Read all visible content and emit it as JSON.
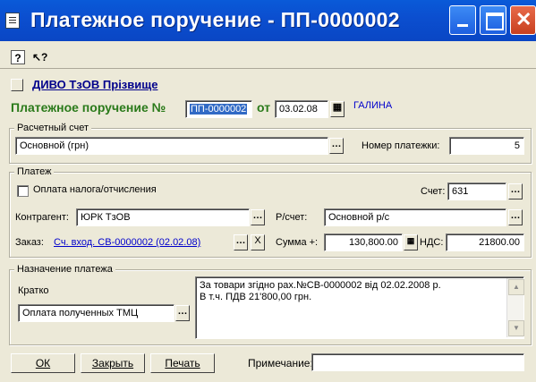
{
  "window": {
    "title": "Платежное поручение - ПП-0000002",
    "close_glyph": "✕"
  },
  "toolbar": {
    "help_glyph": "?",
    "pointer_help_glyph": "↖?"
  },
  "org": {
    "name": "ДИВО ТзОВ Прізвище"
  },
  "header": {
    "doc_label": "Платежное поручение №",
    "doc_number": "ПП-0000002",
    "date_label": "от",
    "date": "03.02.08",
    "user": "ГАЛИНА"
  },
  "account_group": {
    "legend": "Расчетный счет",
    "account": "Основной (грн)",
    "payment_no_label": "Номер платежки:",
    "payment_no": "5"
  },
  "payment_group": {
    "legend": "Платеж",
    "tax_label": "Оплата налога/отчисления",
    "account_label": "Счет:",
    "account": "631",
    "contractor_label": "Контрагент:",
    "contractor": "ЮРК ТзОВ",
    "rs_label": "Р/счет:",
    "rs": "Основной р/с",
    "order_label": "Заказ:",
    "order": "Сч. вход. СВ-0000002 (02.02.08)",
    "clear_glyph": "X",
    "sum_label": "Сумма +:",
    "sum": "130,800.00",
    "vat_label": "НДС:",
    "vat": "21800.00"
  },
  "purpose_group": {
    "legend": "Назначение платежа",
    "short_label": "Кратко",
    "short_value": "Оплата полученных ТМЦ",
    "text_line1": "За товари згідно рах.№СВ-0000002 від 02.02.2008 р.",
    "text_line2": "В т.ч. ПДВ 21'800,00 грн."
  },
  "buttons": {
    "ok": "ОК",
    "close": "Закрыть",
    "print": "Печать"
  },
  "note": {
    "label": "Примечание:",
    "value": ""
  },
  "colors": {
    "title_bar": "#0b4fd0",
    "green_label": "#2a7a1a",
    "link_blue": "#0000cc",
    "selection": "#316AC5"
  }
}
